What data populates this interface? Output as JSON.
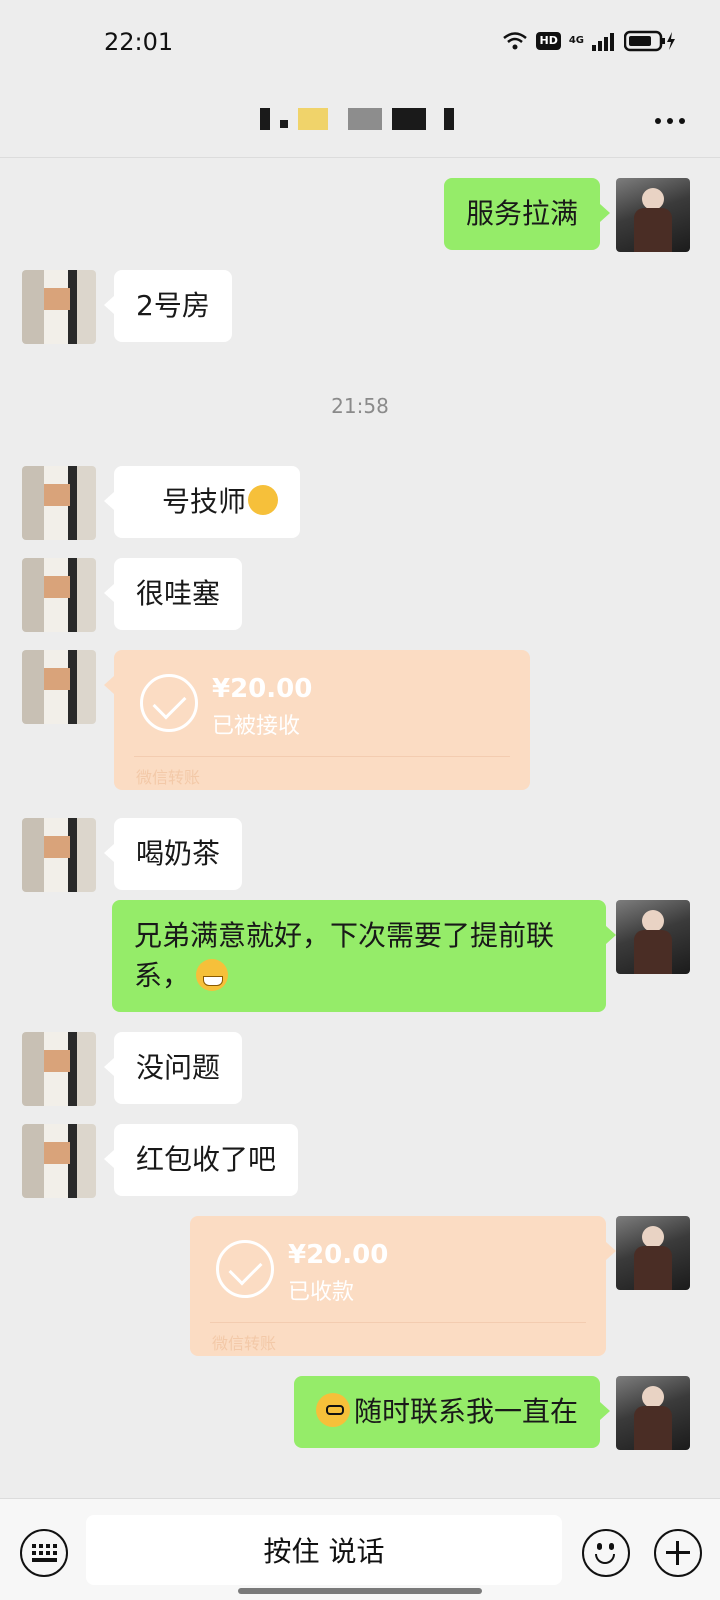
{
  "status_bar": {
    "time": "22:01",
    "hd": "HD",
    "network": "4G"
  },
  "nav": {
    "title_obscured": true
  },
  "messages": [
    {
      "side": "out",
      "text": "服务拉满"
    },
    {
      "side": "in",
      "text": "2号房"
    },
    {
      "timestamp": "21:58"
    },
    {
      "side": "in",
      "text": "号技师",
      "emoji": "thumbs-up"
    },
    {
      "side": "in",
      "text": "很哇塞"
    },
    {
      "side": "in",
      "type": "transfer",
      "amount": "¥20.00",
      "status": "已被接收",
      "footer": "微信转账"
    },
    {
      "side": "in",
      "text": "喝奶茶"
    },
    {
      "side": "out",
      "text": "兄弟满意就好，下次需要了提前联系，",
      "emoji": "grinning"
    },
    {
      "side": "in",
      "text": "没问题"
    },
    {
      "side": "in",
      "text": "红包收了吧"
    },
    {
      "side": "out",
      "type": "transfer",
      "amount": "¥20.00",
      "status": "已收款",
      "footer": "微信转账"
    },
    {
      "side": "out",
      "text": "随时联系我一直在",
      "emoji": "thinking"
    }
  ],
  "input_bar": {
    "voice_label": "按住 说话"
  },
  "colors": {
    "background": "#ededed",
    "bubble_out": "#95ec69",
    "bubble_in": "#ffffff",
    "transfer": "#fbdcc3"
  }
}
